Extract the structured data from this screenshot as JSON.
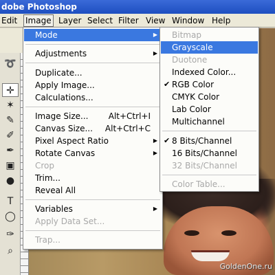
{
  "window": {
    "title": "dobe Photoshop"
  },
  "menubar": {
    "items": [
      "Edit",
      "Image",
      "Layer",
      "Select",
      "Filter",
      "View",
      "Window",
      "Help"
    ],
    "active": "Image"
  },
  "image_menu": {
    "items": [
      {
        "label": "Mode",
        "submenu": true,
        "highlighted": true
      },
      {
        "label": "Adjustments",
        "submenu": true
      },
      {
        "label": "Duplicate..."
      },
      {
        "label": "Apply Image..."
      },
      {
        "label": "Calculations..."
      },
      {
        "label": "Image Size...",
        "shortcut": "Alt+Ctrl+I"
      },
      {
        "label": "Canvas Size...",
        "shortcut": "Alt+Ctrl+C"
      },
      {
        "label": "Pixel Aspect Ratio",
        "submenu": true
      },
      {
        "label": "Rotate Canvas",
        "submenu": true
      },
      {
        "label": "Crop",
        "disabled": true
      },
      {
        "label": "Trim..."
      },
      {
        "label": "Reveal All"
      },
      {
        "label": "Variables",
        "submenu": true
      },
      {
        "label": "Apply Data Set...",
        "disabled": true
      },
      {
        "label": "Trap...",
        "disabled": true
      }
    ]
  },
  "mode_submenu": {
    "items": [
      {
        "label": "Bitmap",
        "disabled": true
      },
      {
        "label": "Grayscale",
        "highlighted": true
      },
      {
        "label": "Duotone",
        "disabled": true
      },
      {
        "label": "Indexed Color..."
      },
      {
        "label": "RGB Color",
        "checked": true
      },
      {
        "label": "CMYK Color"
      },
      {
        "label": "Lab Color"
      },
      {
        "label": "Multichannel"
      },
      {
        "label": "8 Bits/Channel",
        "checked": true
      },
      {
        "label": "16 Bits/Channel"
      },
      {
        "label": "32 Bits/Channel",
        "disabled": true
      },
      {
        "label": "Color Table...",
        "disabled": true
      }
    ]
  },
  "glyphs": {
    "check": "✔",
    "arrow": "▶"
  },
  "watermark": "GoldenOne.ru",
  "colors": {
    "highlight": "#3a78e0",
    "disabled": "#a8a8a8",
    "titlebar": "#1e4fc0"
  }
}
